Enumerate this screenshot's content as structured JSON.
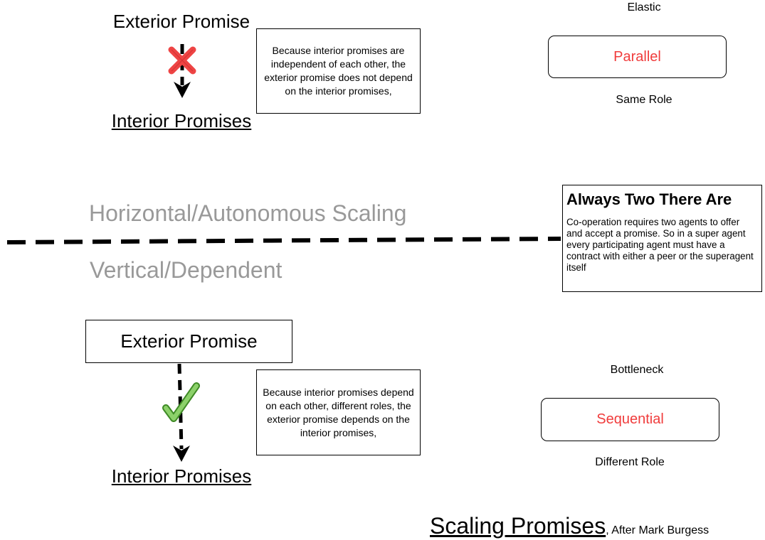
{
  "top": {
    "exterior_title": "Exterior Promise",
    "interior_title": "Interior Promises",
    "note": "Because interior promises are independent of each other, the exterior promise does not depend on the interior promises,",
    "status_icon": "red-x-icon"
  },
  "bottom": {
    "exterior_title": "Exterior Promise",
    "interior_title": "Interior Promises",
    "note": "Because interior promises depend on each other, different roles, the exterior promise depends on the interior promises,",
    "status_icon": "green-check-icon"
  },
  "divider": {
    "above_label": "Horizontal/Autonomous Scaling",
    "below_label": "Vertical/Dependent"
  },
  "parallel": {
    "top_label": "Elastic",
    "box_label": "Parallel",
    "bottom_label": "Same Role"
  },
  "sequential": {
    "top_label": "Bottleneck",
    "box_label": "Sequential",
    "bottom_label": "Different Role"
  },
  "callout": {
    "heading": "Always Two There Are",
    "body": "Co-operation requires two agents to offer and accept a promise. So in a super agent every participating agent must have a contract with either a peer or the superagent itself"
  },
  "footer": {
    "title": "Scaling Promises",
    "attribution": ", After Mark Burgess"
  },
  "colors": {
    "accent_red": "#f03c3c",
    "muted_gray": "#999999",
    "check_green": "#8cd16a",
    "x_red": "#ee4444"
  }
}
